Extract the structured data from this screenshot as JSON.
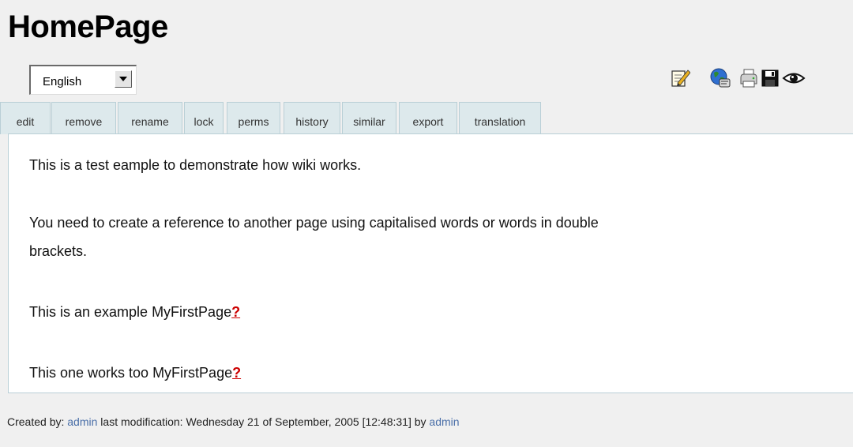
{
  "page": {
    "title": "HomePage"
  },
  "language_select": {
    "selected": "English"
  },
  "toolbar": {
    "icons": [
      "edit-icon",
      "translate-globe-icon",
      "print-icon",
      "save-icon",
      "watch-eye-icon"
    ]
  },
  "tabs": [
    "edit",
    "remove",
    "rename",
    "lock",
    "perms",
    "history",
    "similar",
    "export",
    "translation"
  ],
  "content": {
    "p1": "This is a test eample to demonstrate how wiki works.",
    "p2_line1": "You need to create a reference to another page using capitalised words or words in double",
    "p2_line2": "brackets.",
    "p3_text": "This is an example MyFirstPage",
    "p4_text": "This one works too MyFirstPage",
    "missing_page_marker": "?"
  },
  "footer": {
    "created_label": "Created by:",
    "created_user": "admin",
    "modified_label": "last modification: Wednesday 21 of September, 2005 [12:48:31] by",
    "modified_user": "admin"
  },
  "colors": {
    "tab_bg": "#dde9ec",
    "border": "#b9cfd6",
    "missing_link": "#cc0000",
    "user_link": "#4a6fa8"
  }
}
